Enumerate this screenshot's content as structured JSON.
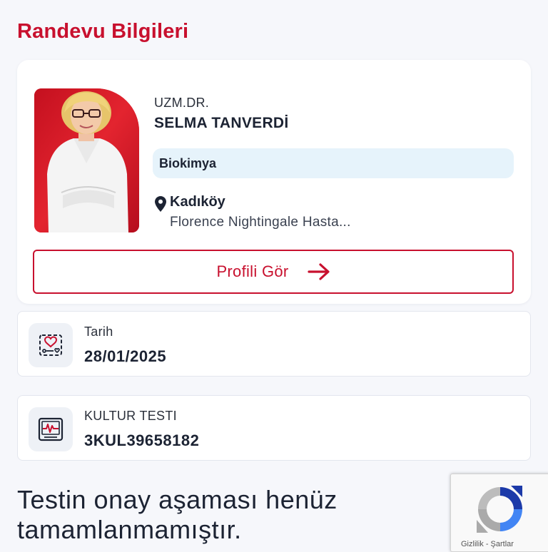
{
  "page": {
    "title": "Randevu Bilgileri"
  },
  "doctor": {
    "title": "UZM.DR.",
    "name": "SELMA TANVERDİ",
    "specialty": "Biokimya",
    "location": "Kadıköy",
    "hospital": "Florence Nightingale Hasta...",
    "profile_button_label": "Profili Gör"
  },
  "date_card": {
    "label": "Tarih",
    "value": "28/01/2025",
    "icon": "calendar-heart-icon"
  },
  "test_card": {
    "label": "KULTUR TESTI",
    "value": "3KUL39658182",
    "icon": "monitor-heartbeat-icon"
  },
  "status": {
    "message": "Testin onay aşaması henüz tamamlanmamıştır."
  },
  "recaptcha": {
    "links": "Gizlilik - Şartlar"
  },
  "colors": {
    "accent": "#c8102e",
    "background": "#f6f7fb",
    "specialty_bg": "#e6f3fb",
    "text": "#1c2333"
  }
}
